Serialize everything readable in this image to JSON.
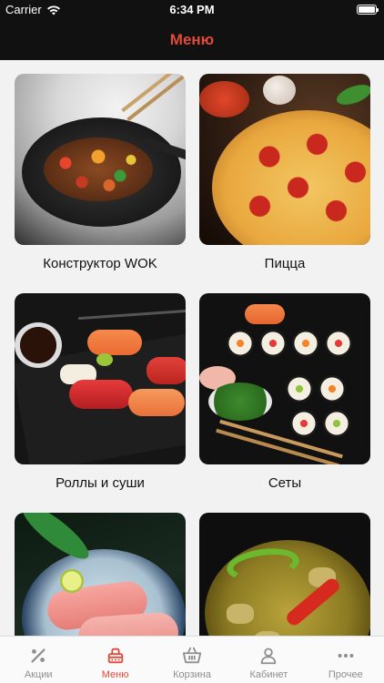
{
  "status_bar": {
    "carrier": "Carrier",
    "time": "6:34 PM"
  },
  "header": {
    "title": "Меню"
  },
  "menu": {
    "items": [
      {
        "label": "Конструктор WOK",
        "image": "wok-stir-fry"
      },
      {
        "label": "Пицца",
        "image": "pepperoni-pizza"
      },
      {
        "label": "Роллы и суши",
        "image": "sushi-nigiri"
      },
      {
        "label": "Сеты",
        "image": "sushi-set"
      },
      {
        "label": "",
        "image": "sashimi-bowl"
      },
      {
        "label": "",
        "image": "vegetable-soup"
      }
    ]
  },
  "tab_bar": {
    "active_tab": "menu",
    "active_color": "#e24a3b",
    "inactive_color": "#8e8e8e",
    "tabs": [
      {
        "id": "promos",
        "label": "Акции",
        "icon": "percent-icon"
      },
      {
        "id": "menu",
        "label": "Меню",
        "icon": "food-delivery-icon"
      },
      {
        "id": "cart",
        "label": "Корзина",
        "icon": "basket-icon"
      },
      {
        "id": "cabinet",
        "label": "Кабинет",
        "icon": "user-icon"
      },
      {
        "id": "more",
        "label": "Прочее",
        "icon": "more-dots-icon"
      }
    ]
  }
}
